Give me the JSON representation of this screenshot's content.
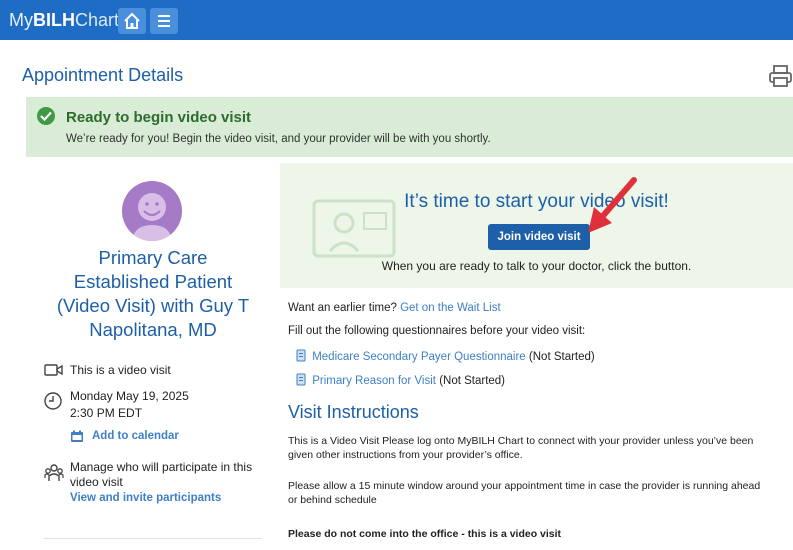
{
  "header": {
    "logo_my": "My",
    "logo_bilh": "BILH",
    "logo_chart": "Chart"
  },
  "page": {
    "title": "Appointment Details"
  },
  "banner": {
    "title": "Ready to begin video visit",
    "description": "We’re ready for you! Begin the video visit, and your provider will be with you shortly."
  },
  "appointment": {
    "title_lines": [
      "Primary Care",
      "Established Patient",
      "(Video Visit) with Guy T",
      "Napolitana, MD"
    ],
    "video_label": "This is a video visit",
    "date": "Monday May 19, 2025",
    "time": "2:30 PM EDT",
    "add_calendar": "Add to calendar",
    "manage_line1": "Manage who will participate in this",
    "manage_line2": "video visit",
    "invite_link": "View and invite participants"
  },
  "hero": {
    "title": "It’s time to start your video visit!",
    "join_button": "Join video visit",
    "subtitle": "When you are ready to talk to your doctor, click the button."
  },
  "waitlist": {
    "prefix": "Want an earlier time?",
    "link": "Get on the Wait List"
  },
  "questionnaires": {
    "intro": "Fill out the following questionnaires before your video visit:",
    "items": [
      {
        "name": "Medicare Secondary Payer Questionnaire",
        "status": "(Not Started)"
      },
      {
        "name": "Primary Reason for Visit",
        "status": "(Not Started)"
      }
    ]
  },
  "instructions": {
    "title": "Visit Instructions",
    "p1_line1": "This is a Video Visit Please log onto MyBILH Chart to connect with your provider unless you’ve been",
    "p1_line2": "given other instructions from your provider’s office.",
    "p2_line1": "Please allow a 15 minute window around your appointment time in case the provider is running ahead",
    "p2_line2": "or behind schedule",
    "p3": "Please do not come into the office - this is a video visit"
  },
  "colors": {
    "header": "#1e6cc4",
    "accent": "#1d5fa8",
    "link": "#3f7fc6",
    "banner_bg": "#d9ecd6",
    "success": "#3f9a47",
    "arrow": "#e0303a"
  }
}
